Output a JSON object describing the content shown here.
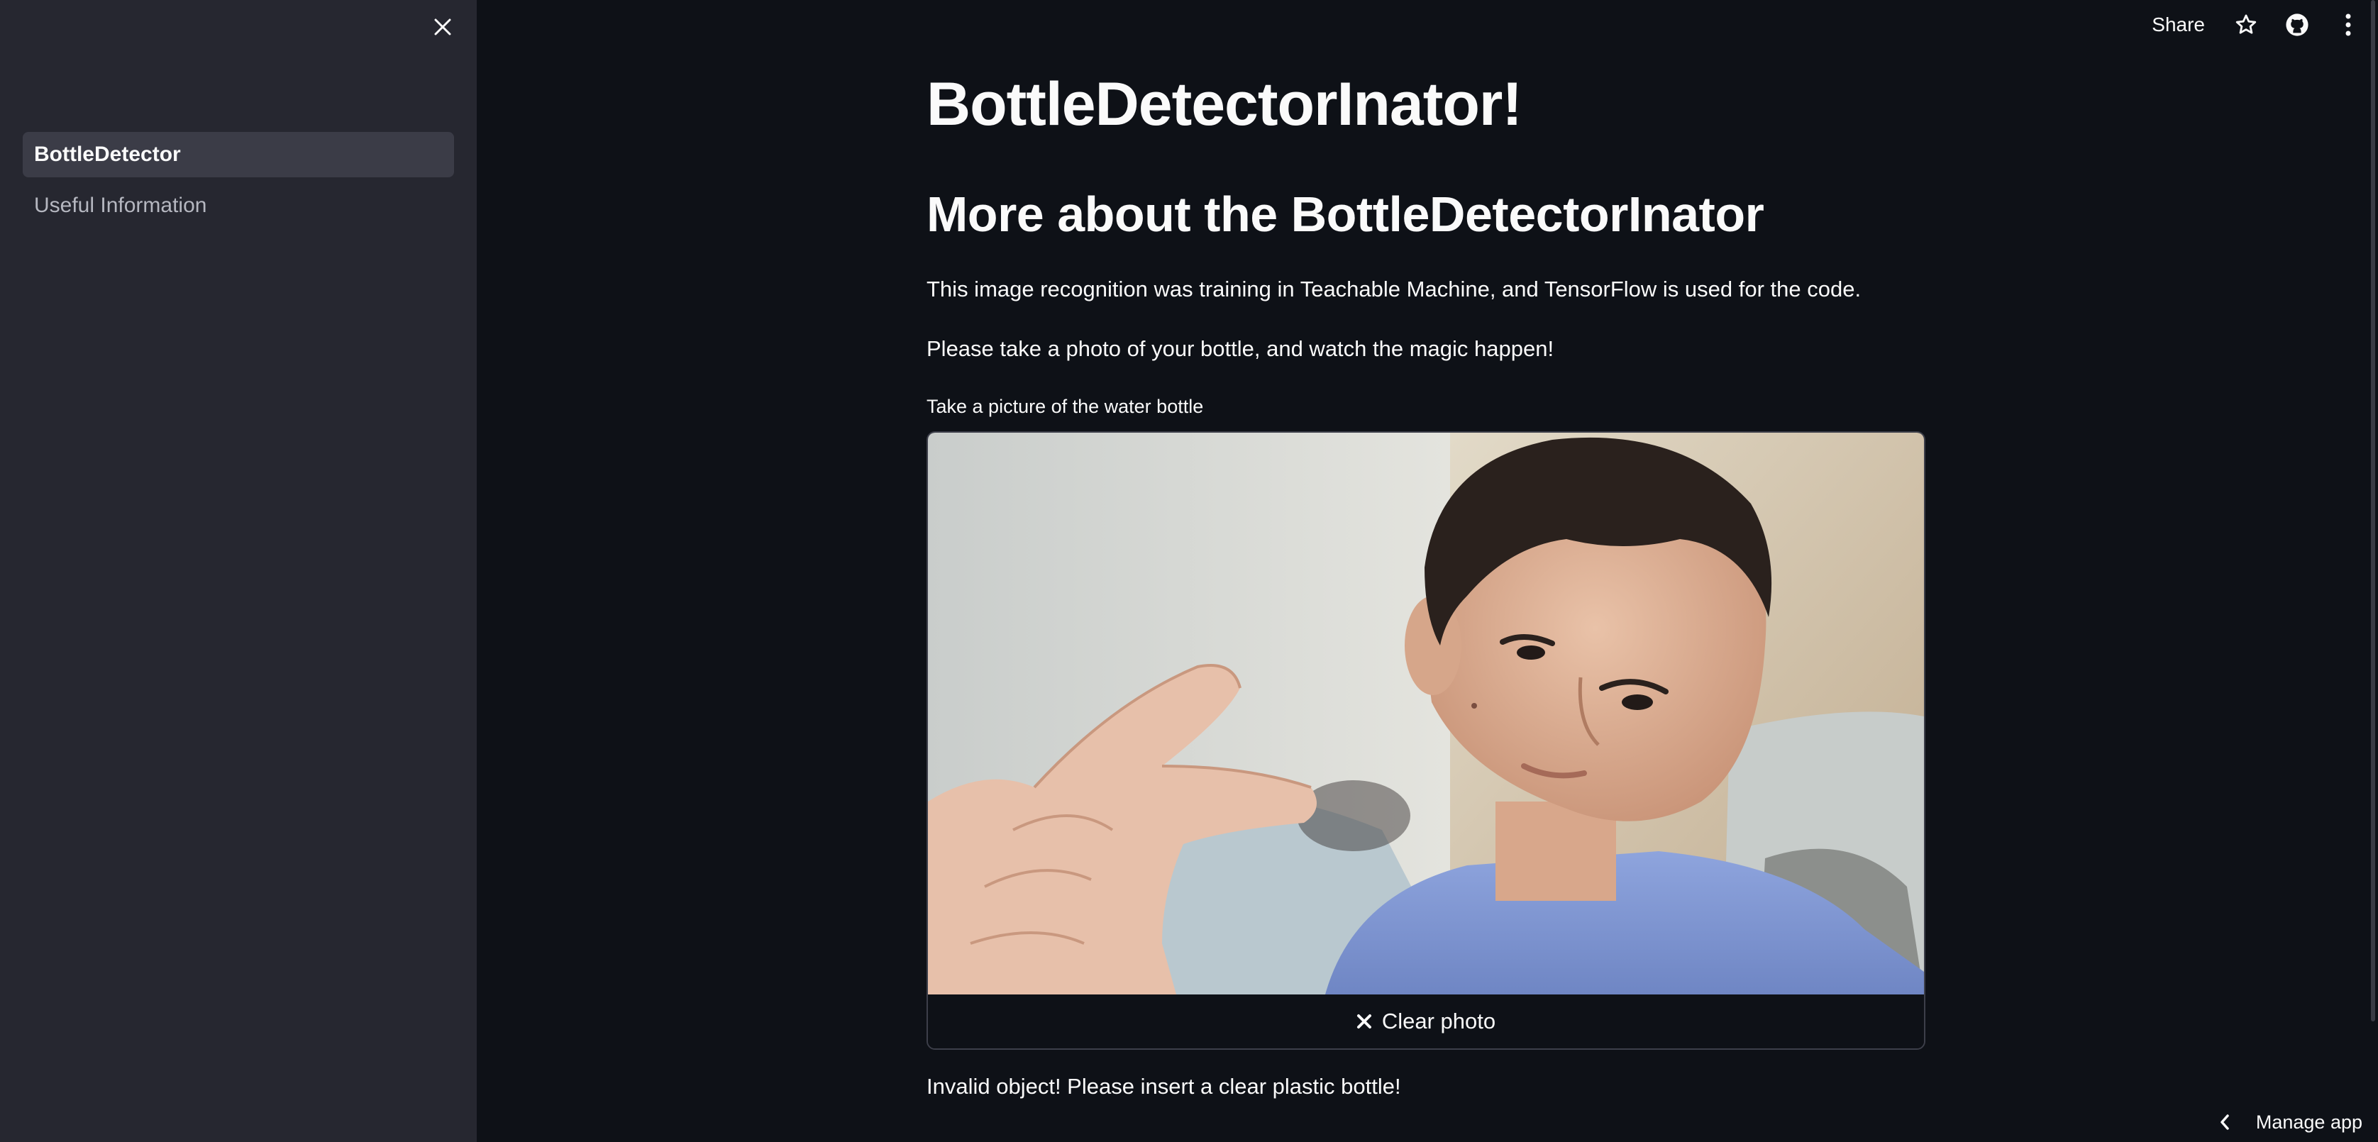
{
  "sidebar": {
    "close_icon": "close-icon",
    "items": [
      {
        "label": "BottleDetector",
        "active": true
      },
      {
        "label": "Useful Information",
        "active": false
      }
    ]
  },
  "topbar": {
    "share_label": "Share",
    "icons": [
      "star-icon",
      "github-icon",
      "more-vertical-icon"
    ]
  },
  "main": {
    "title": "BottleDetectorInator!",
    "subtitle": "More about the BottleDetectorInator",
    "paragraph1": "This image recognition was training in Teachable Machine, and TensorFlow is used for the code.",
    "paragraph2": "Please take a photo of your bottle, and watch the magic happen!",
    "camera_label": "Take a picture of the water bottle",
    "clear_button_label": "Clear photo",
    "result_text": "Invalid object! Please insert a clear plastic bottle!"
  },
  "footer": {
    "manage_label": "Manage app"
  },
  "colors": {
    "background": "#0e1117",
    "sidebar": "#262730",
    "active_item": "#3b3c47",
    "text": "#fafafa",
    "muted_text": "#b5b7c0"
  }
}
